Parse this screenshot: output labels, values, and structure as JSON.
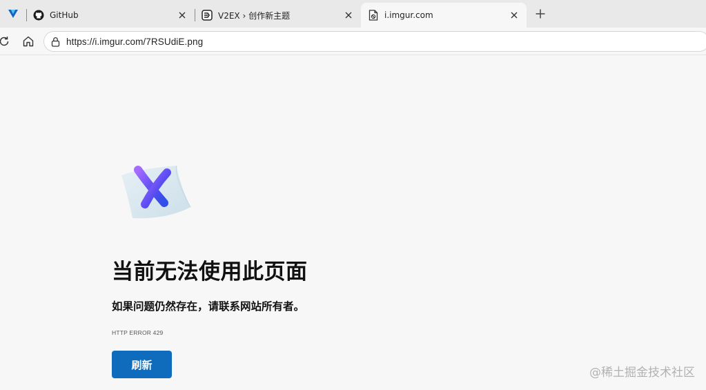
{
  "browser": {
    "tabs": [
      {
        "title": "GitHub",
        "favicon": "github-icon",
        "active": false
      },
      {
        "title": "V2EX › 创作新主题",
        "favicon": "v2ex-icon",
        "active": false
      },
      {
        "title": "i.imgur.com",
        "favicon": "broken-page-icon",
        "active": true
      }
    ],
    "address_bar": {
      "url": "https://i.imgur.com/7RSUdiE.png"
    }
  },
  "error_page": {
    "title": "当前无法使用此页面",
    "subtitle": "如果问题仍然存在，请联系网站所有者。",
    "code": "HTTP ERROR 429",
    "reload_label": "刷新"
  },
  "watermark": "@稀土掘金技术社区",
  "colors": {
    "accent_button": "#0f6cbd",
    "page_background": "#f7f7f7",
    "tabstrip_background": "#e9e9e9"
  }
}
